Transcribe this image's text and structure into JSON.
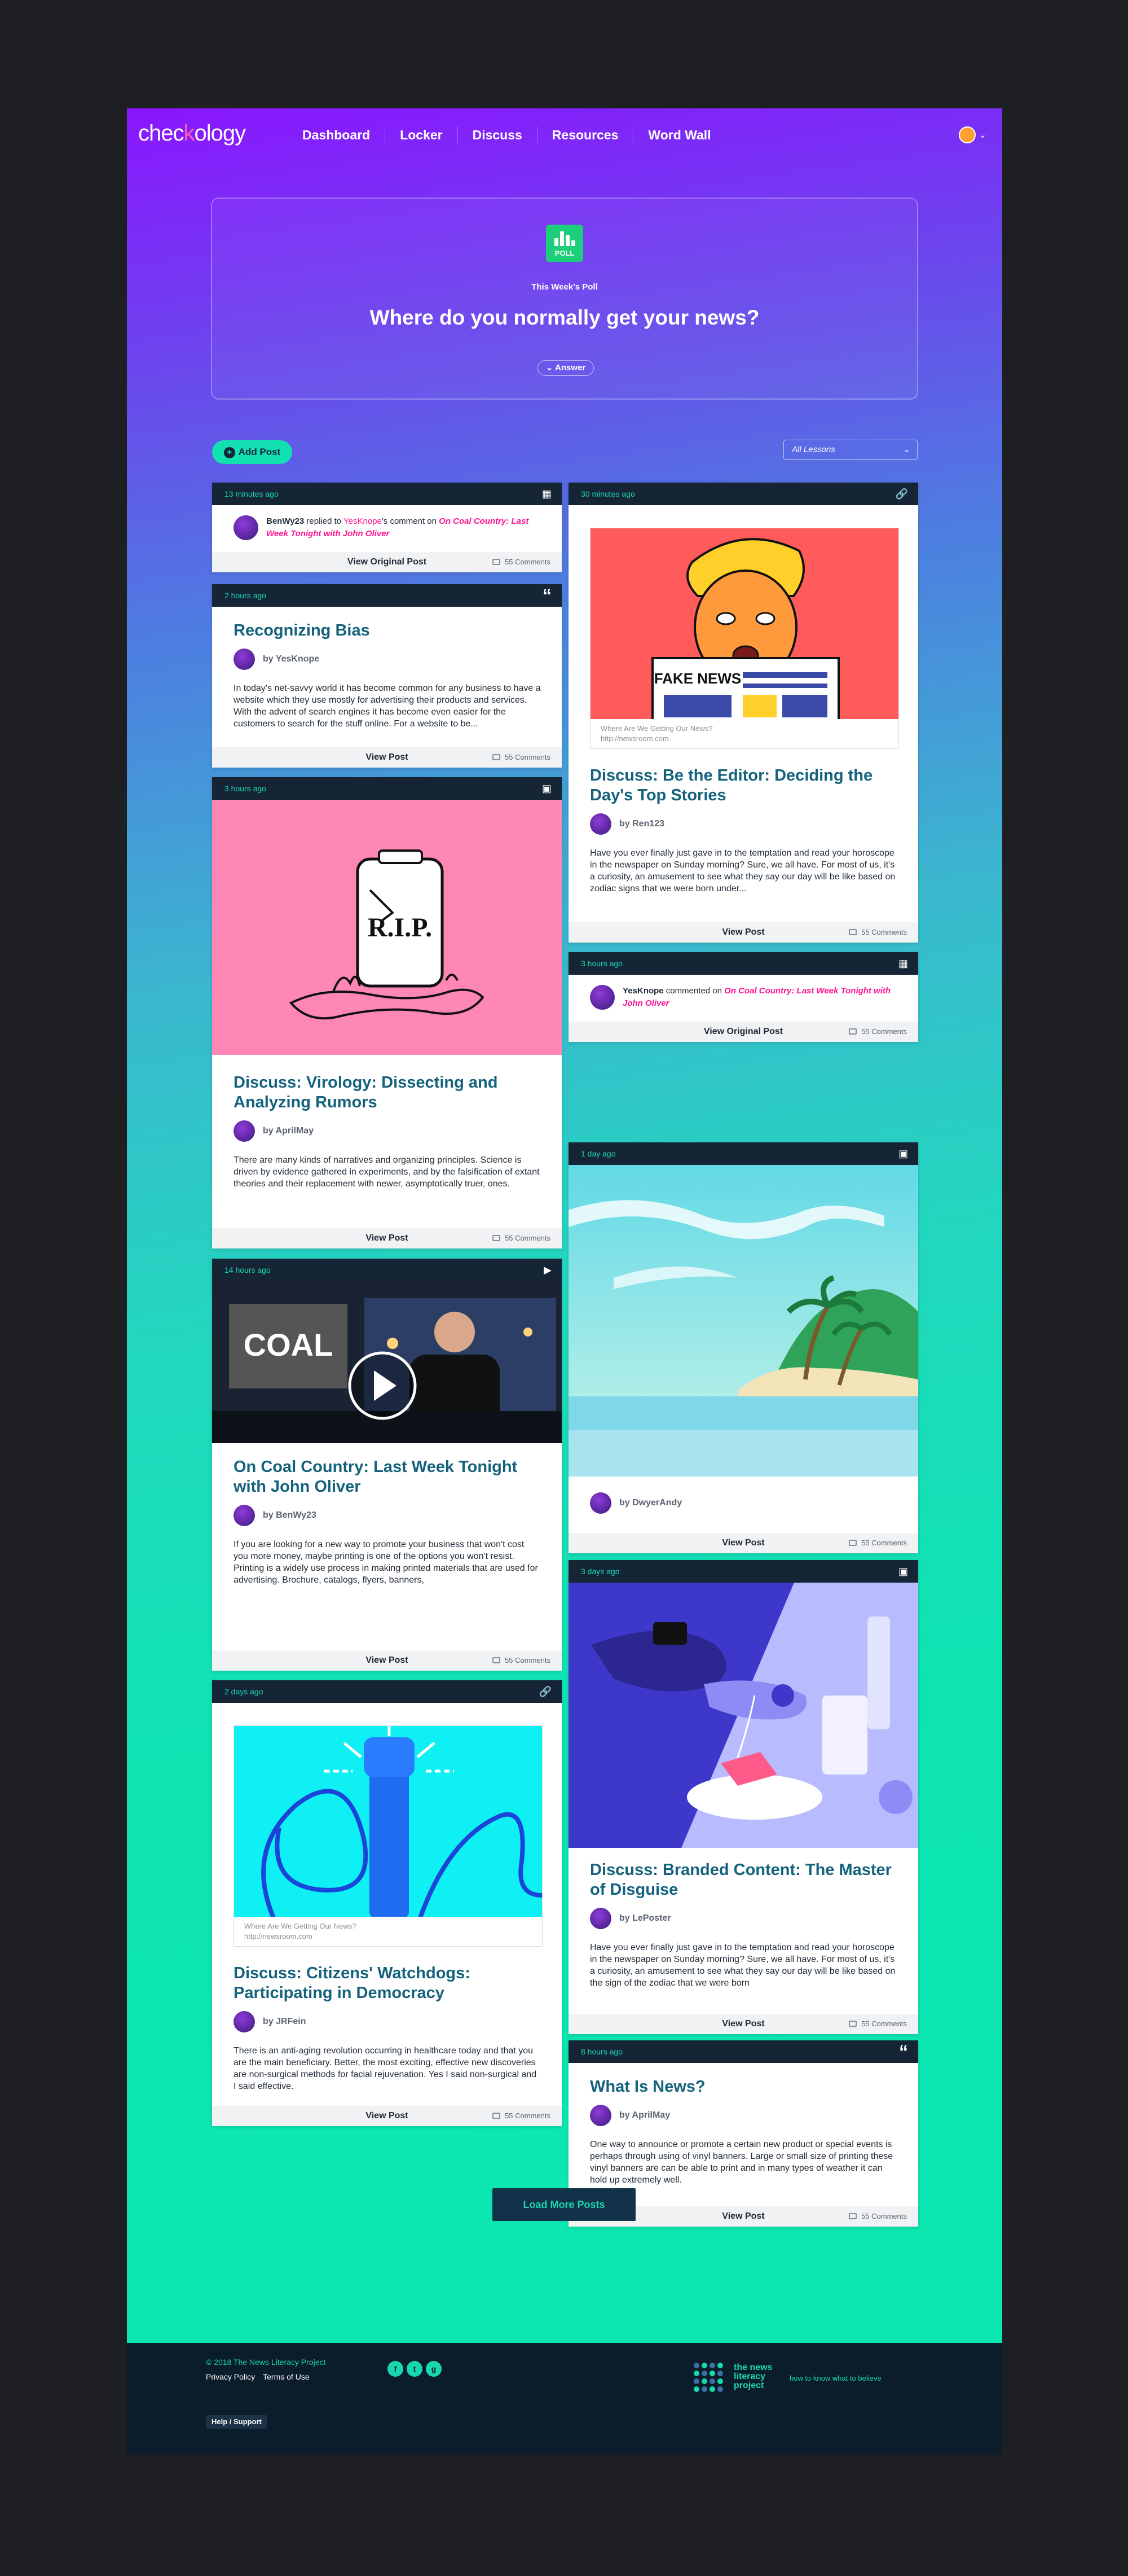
{
  "nav": {
    "logo_a": "chec",
    "logo_k": "k",
    "logo_b": "ology",
    "items": [
      "Dashboard",
      "Locker",
      "Discuss",
      "Resources",
      "Word Wall"
    ]
  },
  "poll": {
    "icon_label": "POLL",
    "kicker": "This Week's Poll",
    "question": "Where do you normally get your news?",
    "answer": "Answer"
  },
  "toolbar": {
    "add_post": "Add Post",
    "filter": "All Lessons"
  },
  "common": {
    "view_post": "View Post",
    "view_original": "View Original Post",
    "comments": "55 Comments",
    "link_title": "Where Are We Getting Our News?",
    "link_url": "http://newsroom.com"
  },
  "cards": {
    "c1": {
      "time": "13 minutes ago",
      "user": "BenWy23",
      "verb": " replied to ",
      "target": "YesKnope",
      "mid": "'s comment on ",
      "post": "On Coal Country: Last Week Tonight with John Oliver"
    },
    "c2": {
      "time": "2 hours ago",
      "title": "Recognizing Bias",
      "author": "by YesKnope",
      "body": "In today's net-savvy world it has become common for any business to have a website which they use mostly for advertising their products and services. With the advent of search engines it has become even easier for the customers to search for the stuff online. For a website to be..."
    },
    "c3": {
      "time": "3 hours ago",
      "title": "Discuss: Virology: Dissecting and Analyzing Rumors",
      "author": "by AprilMay",
      "body": "There are many kinds of narratives and organizing principles. Science is driven by evidence gathered in experiments, and by the falsification of extant theories and their replacement with newer, asymptotically truer, ones."
    },
    "c4": {
      "time": "14 hours ago",
      "title": "On Coal Country: Last Week Tonight with John Oliver",
      "author": "by BenWy23",
      "body": "If you are looking for a new way to promote your business that won't cost you more money, maybe printing is one of the options you won't resist. Printing is a widely use process in making printed materials that are used for advertising. Brochure, catalogs, flyers, banners,",
      "video_label": "COAL"
    },
    "c5": {
      "time": "2 days ago",
      "title": "Discuss: Citizens' Watchdogs: Participating in Democracy",
      "author": "by JRFein",
      "body": "There is an anti-aging revolution occurring in healthcare today and that you are the main beneficiary. Better, the most exciting, effective new discoveries are non-surgical methods for facial rejuvenation. Yes I said non-surgical and I said effective."
    },
    "c6": {
      "time": "30 minutes ago",
      "title": "Discuss: Be the Editor: Deciding the Day's Top Stories",
      "author": "by Ren123",
      "body": "Have you ever finally just gave in to the temptation and read your horoscope in the newspaper on Sunday morning? Sure, we all have. For most of us, it's a curiosity, an amusement to see what they say our day will be like based on zodiac signs that we were born under...",
      "newspaper": "FAKE NEWS"
    },
    "c7": {
      "time": "3 hours ago",
      "user": "YesKnope",
      "verb": " commented on ",
      "post": "On Coal Country: Last Week Tonight with John Oliver"
    },
    "c8": {
      "time": "1 day ago",
      "author": "by DwyerAndy"
    },
    "c9": {
      "time": "3 days ago",
      "title": "Discuss: Branded Content: The Master of Disguise",
      "author": "by LePoster",
      "body": "Have you ever finally just gave in to the temptation and read your horoscope in the newspaper on Sunday morning? Sure, we all have. For most of us, it's a curiosity, an amusement to see what they say our day will be like based on the sign of the zodiac that we were born"
    },
    "c10": {
      "time": "8 hours ago",
      "title": "What Is News?",
      "author": "by AprilMay",
      "body": "One way to announce or promote a certain new product or special events is perhaps through using of vinyl banners. Large or small size of printing these vinyl banners are can be able to print and in many types of weather it can hold up extremely well."
    }
  },
  "load_more": "Load More Posts",
  "footer": {
    "copyright": "© 2018 The News Literacy Project",
    "privacy": "Privacy Policy",
    "terms": "Terms of Use",
    "help": "Help / Support",
    "nlp_name": "the news literacy project",
    "tagline": "how to know what to believe",
    "social": [
      "f",
      "t",
      "g"
    ]
  },
  "colors": {
    "accent": "#19d8b0",
    "pink": "#ff1493",
    "navy": "#152536",
    "title": "#14627c"
  }
}
